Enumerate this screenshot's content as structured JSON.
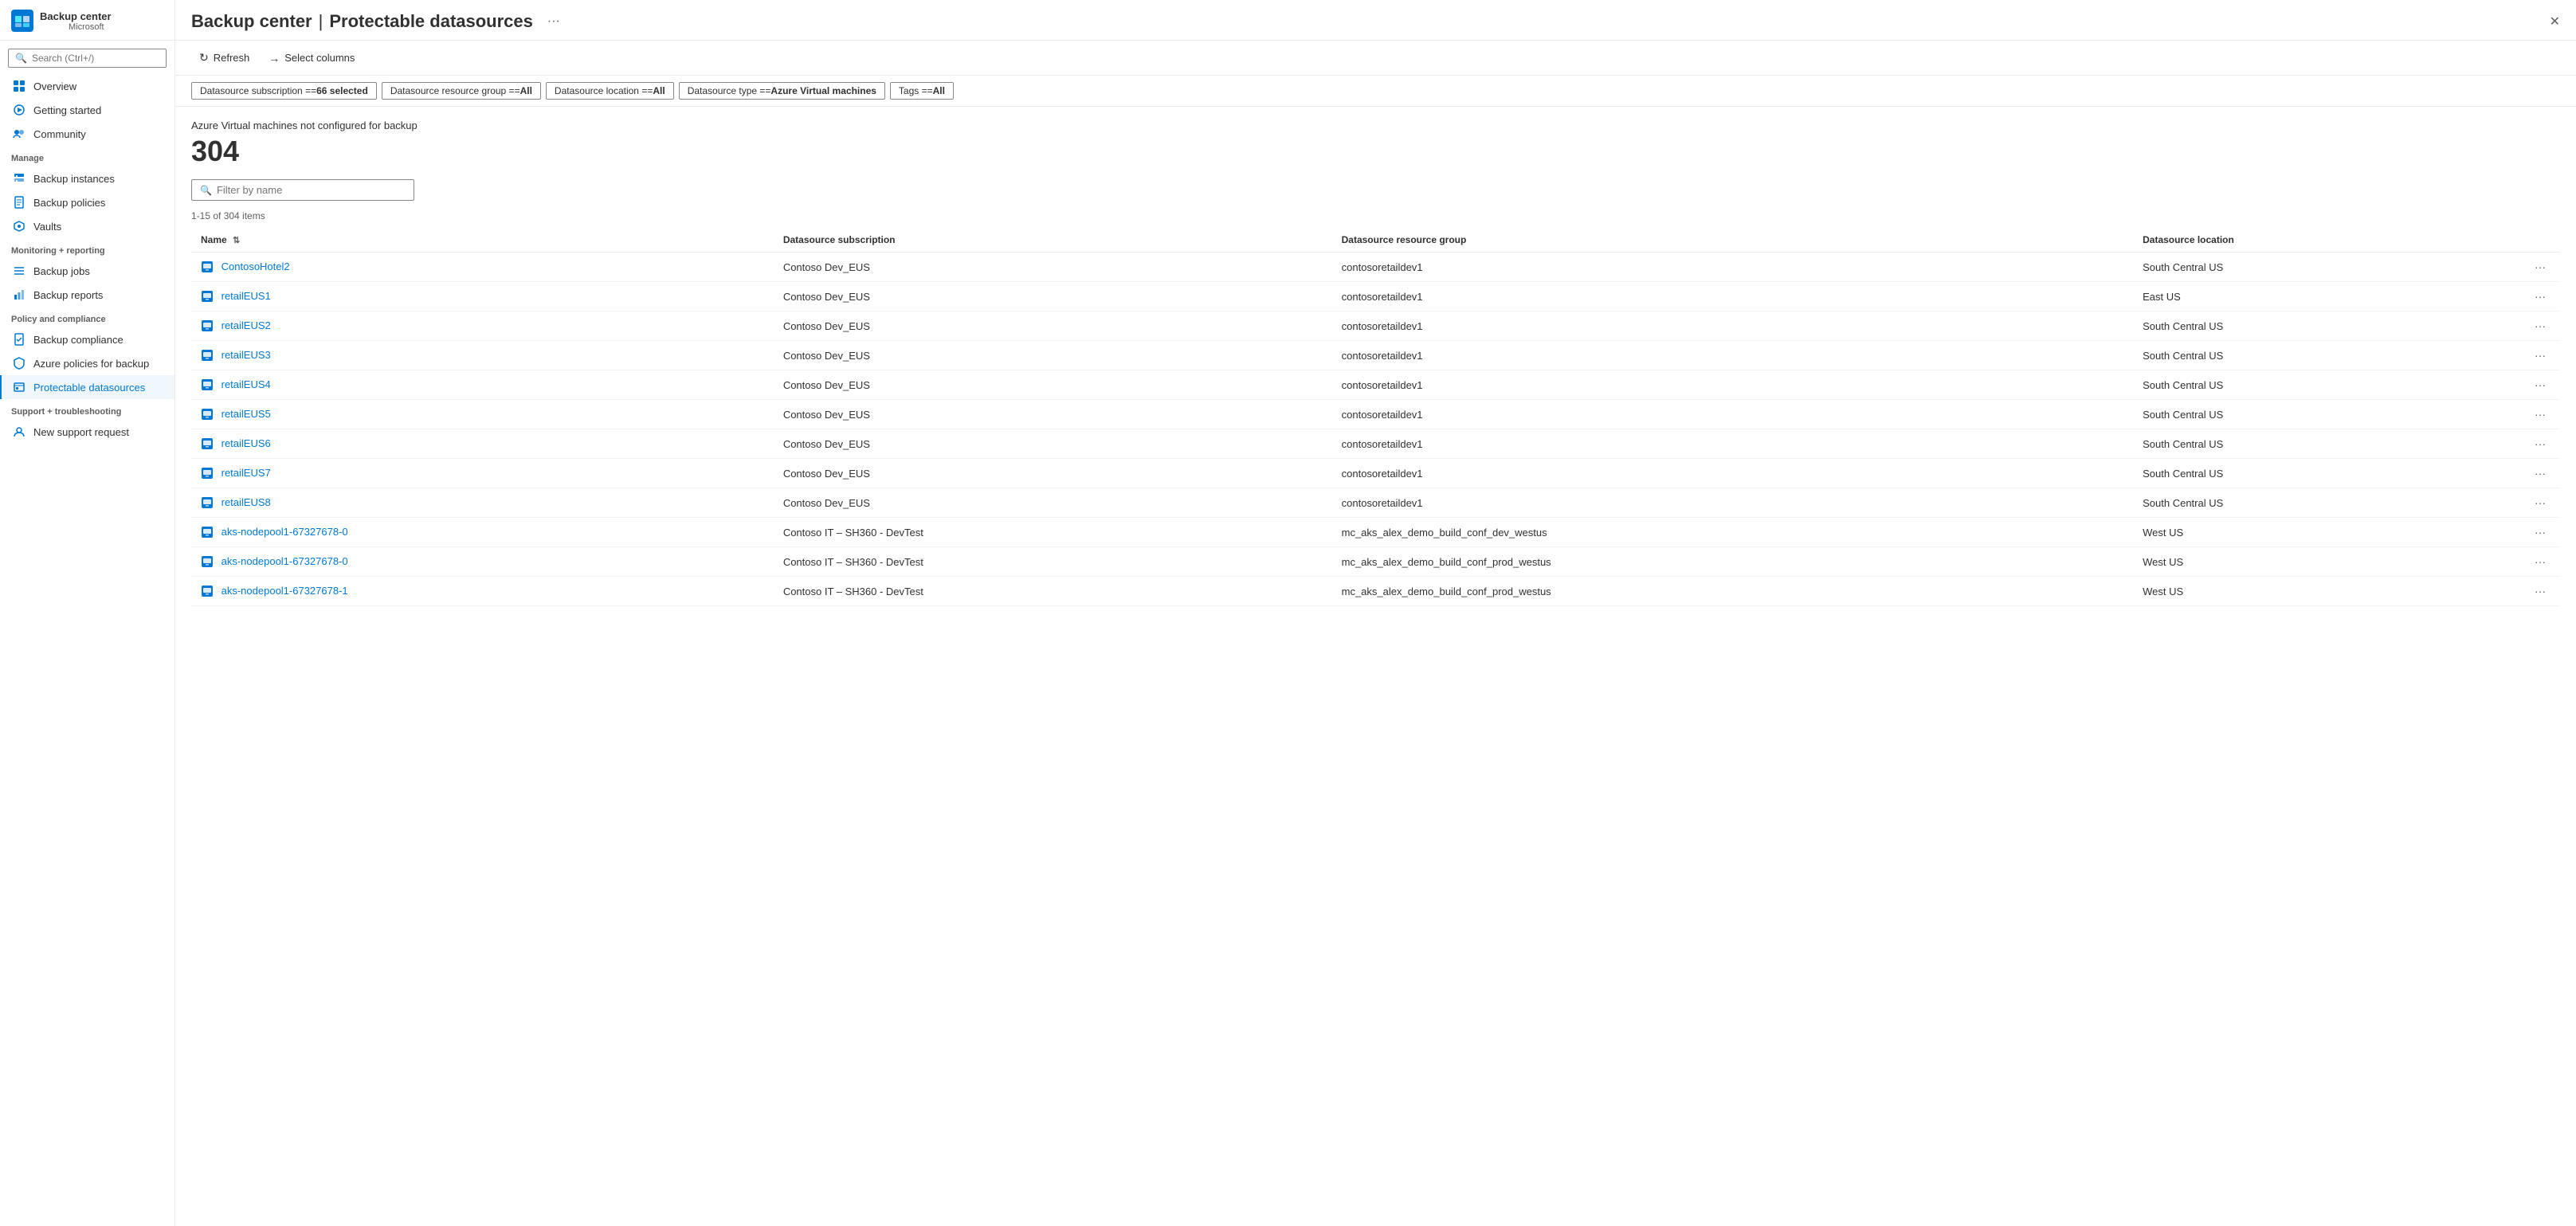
{
  "app": {
    "title": "Backup center",
    "separator": "|",
    "subtitle": "Protectable datasources",
    "provider": "Microsoft"
  },
  "sidebar": {
    "search_placeholder": "Search (Ctrl+/)",
    "nav_items": [
      {
        "id": "overview",
        "label": "Overview",
        "icon": "⊞",
        "section": null
      },
      {
        "id": "getting-started",
        "label": "Getting started",
        "icon": "🚀",
        "section": null
      },
      {
        "id": "community",
        "label": "Community",
        "icon": "👥",
        "section": null
      }
    ],
    "sections": [
      {
        "label": "Manage",
        "items": [
          {
            "id": "backup-instances",
            "label": "Backup instances",
            "icon": "📋"
          },
          {
            "id": "backup-policies",
            "label": "Backup policies",
            "icon": "📄"
          },
          {
            "id": "vaults",
            "label": "Vaults",
            "icon": "☁️"
          }
        ]
      },
      {
        "label": "Monitoring + reporting",
        "items": [
          {
            "id": "backup-jobs",
            "label": "Backup jobs",
            "icon": "≡"
          },
          {
            "id": "backup-reports",
            "label": "Backup reports",
            "icon": "📊"
          }
        ]
      },
      {
        "label": "Policy and compliance",
        "items": [
          {
            "id": "backup-compliance",
            "label": "Backup compliance",
            "icon": "📋"
          },
          {
            "id": "azure-policies",
            "label": "Azure policies for backup",
            "icon": "🛡️"
          },
          {
            "id": "protectable-datasources",
            "label": "Protectable datasources",
            "icon": "📁",
            "active": true
          }
        ]
      },
      {
        "label": "Support + troubleshooting",
        "items": [
          {
            "id": "new-support-request",
            "label": "New support request",
            "icon": "👤"
          }
        ]
      }
    ]
  },
  "toolbar": {
    "refresh_label": "Refresh",
    "select_columns_label": "Select columns"
  },
  "filters": [
    {
      "id": "subscription",
      "label": "Datasource subscription == ",
      "value": "66 selected",
      "bold": true
    },
    {
      "id": "resource-group",
      "label": "Datasource resource group == ",
      "value": "All",
      "bold": true
    },
    {
      "id": "location",
      "label": "Datasource location == ",
      "value": "All",
      "bold": true
    },
    {
      "id": "type",
      "label": "Datasource type == ",
      "value": "Azure Virtual machines",
      "bold": true
    },
    {
      "id": "tags",
      "label": "Tags == ",
      "value": "All",
      "bold": true
    }
  ],
  "content": {
    "vm_not_configured_label": "Azure Virtual machines not configured for backup",
    "count": "304",
    "filter_placeholder": "Filter by name",
    "items_range": "1-15 of 304 items",
    "columns": [
      {
        "id": "name",
        "label": "Name",
        "sortable": true
      },
      {
        "id": "subscription",
        "label": "Datasource subscription",
        "sortable": false
      },
      {
        "id": "resource-group",
        "label": "Datasource resource group",
        "sortable": false
      },
      {
        "id": "location",
        "label": "Datasource location",
        "sortable": false
      }
    ],
    "rows": [
      {
        "name": "ContosoHotel2",
        "subscription": "Contoso Dev_EUS",
        "resource_group": "contosoretaildev1",
        "location": "South Central US"
      },
      {
        "name": "retailEUS1",
        "subscription": "Contoso Dev_EUS",
        "resource_group": "contosoretaildev1",
        "location": "East US"
      },
      {
        "name": "retailEUS2",
        "subscription": "Contoso Dev_EUS",
        "resource_group": "contosoretaildev1",
        "location": "South Central US"
      },
      {
        "name": "retailEUS3",
        "subscription": "Contoso Dev_EUS",
        "resource_group": "contosoretaildev1",
        "location": "South Central US"
      },
      {
        "name": "retailEUS4",
        "subscription": "Contoso Dev_EUS",
        "resource_group": "contosoretaildev1",
        "location": "South Central US"
      },
      {
        "name": "retailEUS5",
        "subscription": "Contoso Dev_EUS",
        "resource_group": "contosoretaildev1",
        "location": "South Central US"
      },
      {
        "name": "retailEUS6",
        "subscription": "Contoso Dev_EUS",
        "resource_group": "contosoretaildev1",
        "location": "South Central US"
      },
      {
        "name": "retailEUS7",
        "subscription": "Contoso Dev_EUS",
        "resource_group": "contosoretaildev1",
        "location": "South Central US"
      },
      {
        "name": "retailEUS8",
        "subscription": "Contoso Dev_EUS",
        "resource_group": "contosoretaildev1",
        "location": "South Central US"
      },
      {
        "name": "aks-nodepool1-67327678-0",
        "subscription": "Contoso IT – SH360 - DevTest",
        "resource_group": "mc_aks_alex_demo_build_conf_dev_westus",
        "location": "West US"
      },
      {
        "name": "aks-nodepool1-67327678-0",
        "subscription": "Contoso IT – SH360 - DevTest",
        "resource_group": "mc_aks_alex_demo_build_conf_prod_westus",
        "location": "West US"
      },
      {
        "name": "aks-nodepool1-67327678-1",
        "subscription": "Contoso IT – SH360 - DevTest",
        "resource_group": "mc_aks_alex_demo_build_conf_prod_westus",
        "location": "West US"
      }
    ]
  },
  "colors": {
    "accent": "#0078d4",
    "active_bg": "#eff6fc",
    "border": "#edebe9",
    "text_primary": "#323130",
    "text_secondary": "#605e5c"
  }
}
